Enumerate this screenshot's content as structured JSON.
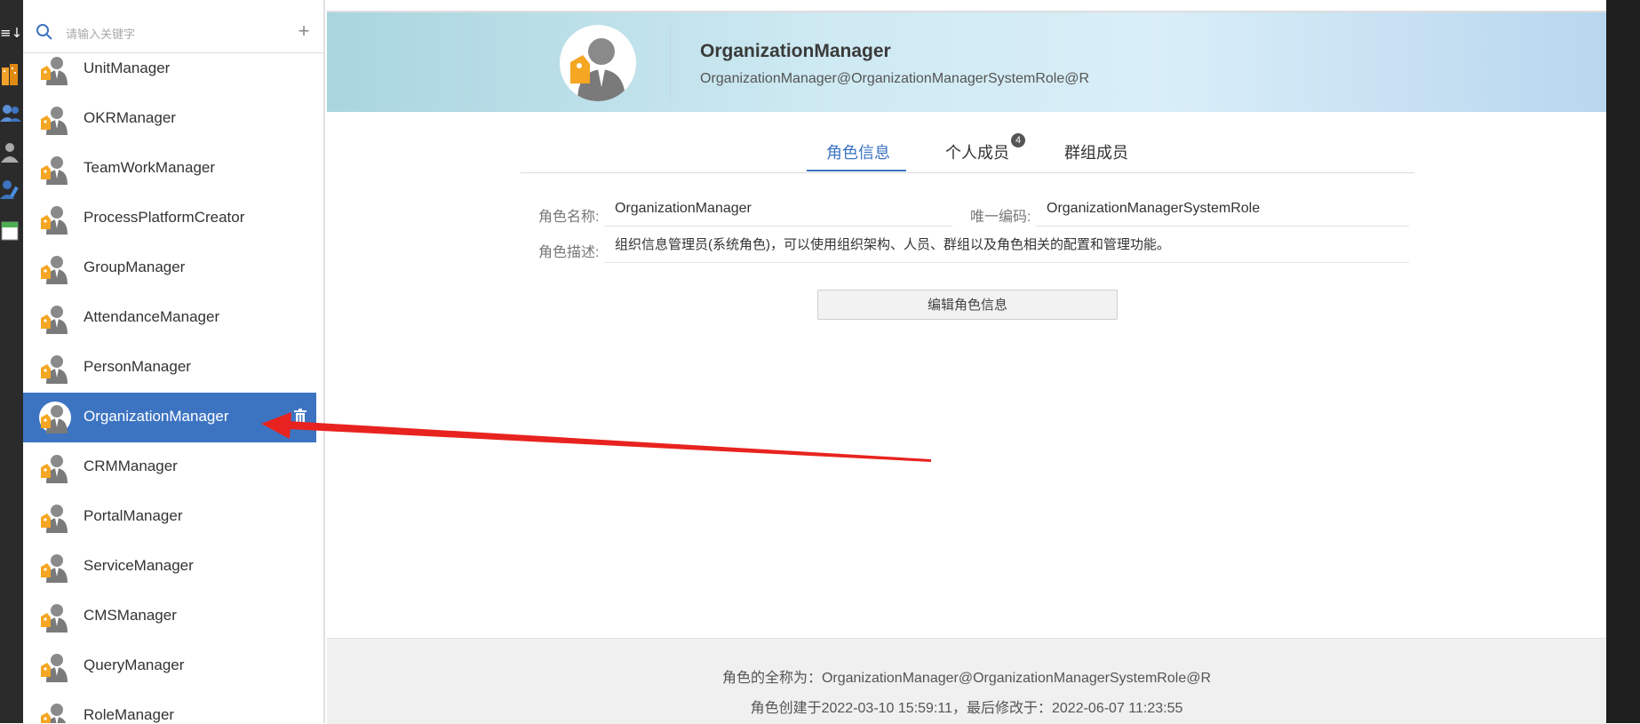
{
  "search": {
    "placeholder": "请输入关键字",
    "add_label": "+"
  },
  "roles": [
    {
      "label": "UnitManager",
      "selected": false
    },
    {
      "label": "OKRManager",
      "selected": false
    },
    {
      "label": "TeamWorkManager",
      "selected": false
    },
    {
      "label": "ProcessPlatformCreator",
      "selected": false
    },
    {
      "label": "GroupManager",
      "selected": false
    },
    {
      "label": "AttendanceManager",
      "selected": false
    },
    {
      "label": "PersonManager",
      "selected": false
    },
    {
      "label": "OrganizationManager",
      "selected": true
    },
    {
      "label": "CRMManager",
      "selected": false
    },
    {
      "label": "PortalManager",
      "selected": false
    },
    {
      "label": "ServiceManager",
      "selected": false
    },
    {
      "label": "CMSManager",
      "selected": false
    },
    {
      "label": "QueryManager",
      "selected": false
    },
    {
      "label": "RoleManager",
      "selected": false
    }
  ],
  "header": {
    "title": "OrganizationManager",
    "subtitle": "OrganizationManager@OrganizationManagerSystemRole@R"
  },
  "tabs": [
    {
      "label": "角色信息",
      "active": true
    },
    {
      "label": "个人成员",
      "active": false,
      "badge": "4"
    },
    {
      "label": "群组成员",
      "active": false
    }
  ],
  "form": {
    "name_label": "角色名称:",
    "name_value": "OrganizationManager",
    "code_label": "唯一编码:",
    "code_value": "OrganizationManagerSystemRole",
    "desc_label": "角色描述:",
    "desc_value": "组织信息管理员(系统角色)，可以使用组织架构、人员、群组以及角色相关的配置和管理功能。"
  },
  "edit_button": "编辑角色信息",
  "footer": {
    "full_name": "角色的全称为：OrganizationManager@OrganizationManagerSystemRole@R",
    "dates": "角色创建于2022-03-10 15:59:11，最后修改于：2022-06-07 11:23:55"
  },
  "colors": {
    "accent": "#3d74c2",
    "annotation_arrow": "#e8231f"
  },
  "icons": {
    "search": "search-icon",
    "add": "plus-icon",
    "role": "role-avatar-icon",
    "delete": "trash-icon"
  }
}
